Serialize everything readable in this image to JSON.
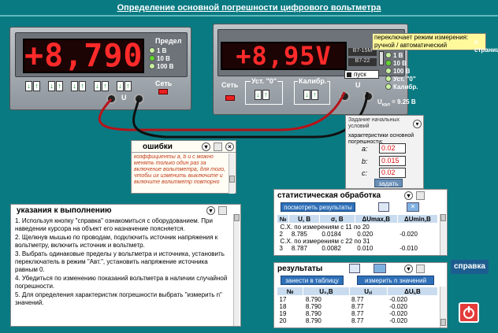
{
  "title": "Определение основной погрешности цифрового вольтметра",
  "source": {
    "display": "+8,790",
    "limit_label": "Предел",
    "ranges": [
      "1 В",
      "10 В",
      "100 В"
    ],
    "net_label": "Сеть",
    "u_label": "U"
  },
  "voltmeter": {
    "display": "+8,95V",
    "model1": "В7-15М",
    "model2": "В7-22",
    "start_label": "пуск",
    "net_label": "Сеть",
    "zero_label": "Уст. \"0\"",
    "calib_label": "Калибр.",
    "u_label": "U",
    "ranges": [
      "1 В",
      "10 В",
      "100 В",
      "Уст. \"0\"",
      "Калибр."
    ],
    "ucal": "U",
    "ucal_sub": "кал",
    "ucal_val": " = 9.25 В"
  },
  "tooltip": "переключает режим измерения: ручной / автоматический",
  "help_corner": "о страницу",
  "init": {
    "title": "Задание начальных условий",
    "subtitle": "характеристики основной погрешности:",
    "a_label": "a:",
    "a": "0.02",
    "b_label": "b:",
    "b": "0.015",
    "c_label": "c:",
    "c": "0.02",
    "set_btn": "задать"
  },
  "errors": {
    "title": "ошибки",
    "text": "коэффициенты a, b и c можно менять только один раз за включение вольтметра, для того, чтобы их изменить выключите и включите вольтметр повторно"
  },
  "instructions": {
    "title": "указания к выполнению",
    "items": [
      "1.       Используя кнопку \"справка\" ознакомиться с оборудованием. При наведении курсора на объект его назначение поясняется.",
      "2.       Щелкнув мышью по проводам, подключить источник напряжения к вольтметру, включить источник и вольтметр.",
      "3.       Выбрать одинаковые пределы у вольтметра и источника, установить переключатель в режим \"Авт.\", установить напряжение источника равным 0.",
      "4.       Убедиться по изменению показаний вольтметра в наличии случайной погрешности.",
      "5.       Для определения характеристик погрешности выбрать \"измерить n\" значений."
    ]
  },
  "stats": {
    "title": "статистическая обработка",
    "show_btn": "посмотреть результаты",
    "headers": [
      "№",
      "U, В",
      "σ, В",
      "ΔUmax,В",
      "ΔUmin,В"
    ],
    "rows": [
      {
        "span": "С.Х. по измерениям с 11 по 20"
      },
      {
        "cells": [
          "2",
          "8.785",
          "0.0184",
          "0.020",
          "-0.020"
        ]
      },
      {
        "span": "С.Х. по измерениям с 22 по 31"
      },
      {
        "cells": [
          "3",
          "8.787",
          "0.0082",
          "0.010",
          "-0.010"
        ]
      }
    ]
  },
  "results": {
    "title": "результаты",
    "add_btn": "занести в таблицу",
    "measure_btn": "измерить n значений",
    "headers": [
      "№",
      "U₀,В",
      "Uₓᵢ",
      "ΔUᵢ,В"
    ],
    "rows": [
      [
        "17",
        "8.790",
        "8.77",
        "-0.020"
      ],
      [
        "18",
        "8.790",
        "8.77",
        "-0.020"
      ],
      [
        "19",
        "8.790",
        "8.77",
        "-0.020"
      ],
      [
        "20",
        "8.790",
        "8.77",
        "-0.020"
      ]
    ]
  },
  "help_btn": "справка",
  "colors": {
    "bg": "#0a7a82",
    "led": "#ff2a2a",
    "power": "#e43b3b"
  }
}
